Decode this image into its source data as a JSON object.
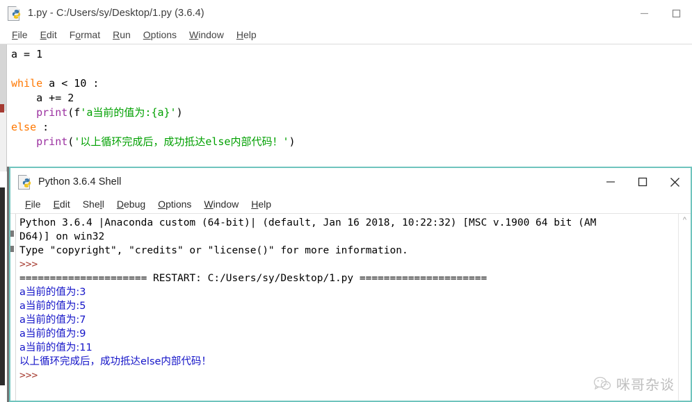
{
  "editor_window": {
    "title": "1.py - C:/Users/sy/Desktop/1.py (3.6.4)",
    "icon": "python-file-icon",
    "menu": [
      {
        "label": "File",
        "accel": "F"
      },
      {
        "label": "Edit",
        "accel": "E"
      },
      {
        "label": "Format",
        "accel": "o"
      },
      {
        "label": "Run",
        "accel": "R"
      },
      {
        "label": "Options",
        "accel": "O"
      },
      {
        "label": "Window",
        "accel": "W"
      },
      {
        "label": "Help",
        "accel": "H"
      }
    ],
    "window_buttons": [
      {
        "name": "minimize-button",
        "glyph": "minimize"
      },
      {
        "name": "maximize-button",
        "glyph": "maximize"
      }
    ],
    "code_lines": [
      {
        "tokens": [
          {
            "t": "a = 1",
            "c": "plain"
          }
        ]
      },
      {
        "tokens": []
      },
      {
        "tokens": [
          {
            "t": "while",
            "c": "kw"
          },
          {
            "t": " a < 10 :",
            "c": "plain"
          }
        ]
      },
      {
        "tokens": [
          {
            "t": "    a += 2",
            "c": "plain"
          }
        ]
      },
      {
        "tokens": [
          {
            "t": "    ",
            "c": "plain"
          },
          {
            "t": "print",
            "c": "fn"
          },
          {
            "t": "(f",
            "c": "plain"
          },
          {
            "t": "'a当前的值为:",
            "c": "str"
          },
          {
            "t": "{a}",
            "c": "str"
          },
          {
            "t": "'",
            "c": "str"
          },
          {
            "t": ")",
            "c": "plain"
          }
        ]
      },
      {
        "tokens": [
          {
            "t": "else",
            "c": "kw"
          },
          {
            "t": " :",
            "c": "plain"
          }
        ]
      },
      {
        "tokens": [
          {
            "t": "    ",
            "c": "plain"
          },
          {
            "t": "print",
            "c": "fn"
          },
          {
            "t": "(",
            "c": "plain"
          },
          {
            "t": "'以上循环完成后，成功抵达else内部代码！'",
            "c": "str"
          },
          {
            "t": ")",
            "c": "plain"
          }
        ]
      }
    ],
    "code_plain_text": "a = 1\n\nwhile a < 10 :\n    a += 2\n    print(f'a当前的值为:{a}')\nelse :\n    print('以上循环完成后，成功抵达else内部代码！')"
  },
  "shell_window": {
    "title": "Python 3.6.4 Shell",
    "icon": "python-file-icon",
    "menu": [
      {
        "label": "File",
        "accel": "F"
      },
      {
        "label": "Edit",
        "accel": "E"
      },
      {
        "label": "Shell",
        "accel": "l"
      },
      {
        "label": "Debug",
        "accel": "D"
      },
      {
        "label": "Options",
        "accel": "O"
      },
      {
        "label": "Window",
        "accel": "W"
      },
      {
        "label": "Help",
        "accel": "H"
      }
    ],
    "window_buttons": [
      {
        "name": "minimize-button",
        "glyph": "minimize"
      },
      {
        "name": "maximize-button",
        "glyph": "maximize"
      },
      {
        "name": "close-button",
        "glyph": "close"
      }
    ],
    "output_lines": [
      {
        "c": "plain",
        "t": "Python 3.6.4 |Anaconda custom (64-bit)| (default, Jan 16 2018, 10:22:32) [MSC v.1900 64 bit (AM"
      },
      {
        "c": "plain",
        "t": "D64)] on win32"
      },
      {
        "c": "plain",
        "t": "Type \"copyright\", \"credits\" or \"license()\" for more information."
      },
      {
        "c": "prompt",
        "t": ">>>"
      },
      {
        "c": "plain",
        "t": "===================== RESTART: C:/Users/sy/Desktop/1.py ====================="
      },
      {
        "c": "outp",
        "t": "a当前的值为:3"
      },
      {
        "c": "outp",
        "t": "a当前的值为:5"
      },
      {
        "c": "outp",
        "t": "a当前的值为:7"
      },
      {
        "c": "outp",
        "t": "a当前的值为:9"
      },
      {
        "c": "outp",
        "t": "a当前的值为:11"
      },
      {
        "c": "outp",
        "t": "以上循环完成后，成功抵达else内部代码！"
      },
      {
        "c": "prompt",
        "t": ">>>"
      }
    ],
    "scrollbar": {
      "up_arrow": "^"
    }
  },
  "watermark": {
    "text": "咪哥杂谈",
    "icon": "wechat-logo-icon"
  },
  "colors": {
    "keyword": "#ff7700",
    "function": "#9b30a0",
    "string": "#00a000",
    "shell_output": "#1414c8",
    "shell_prompt": "#a5392e",
    "window_border_accent": "#6fc4bd"
  }
}
